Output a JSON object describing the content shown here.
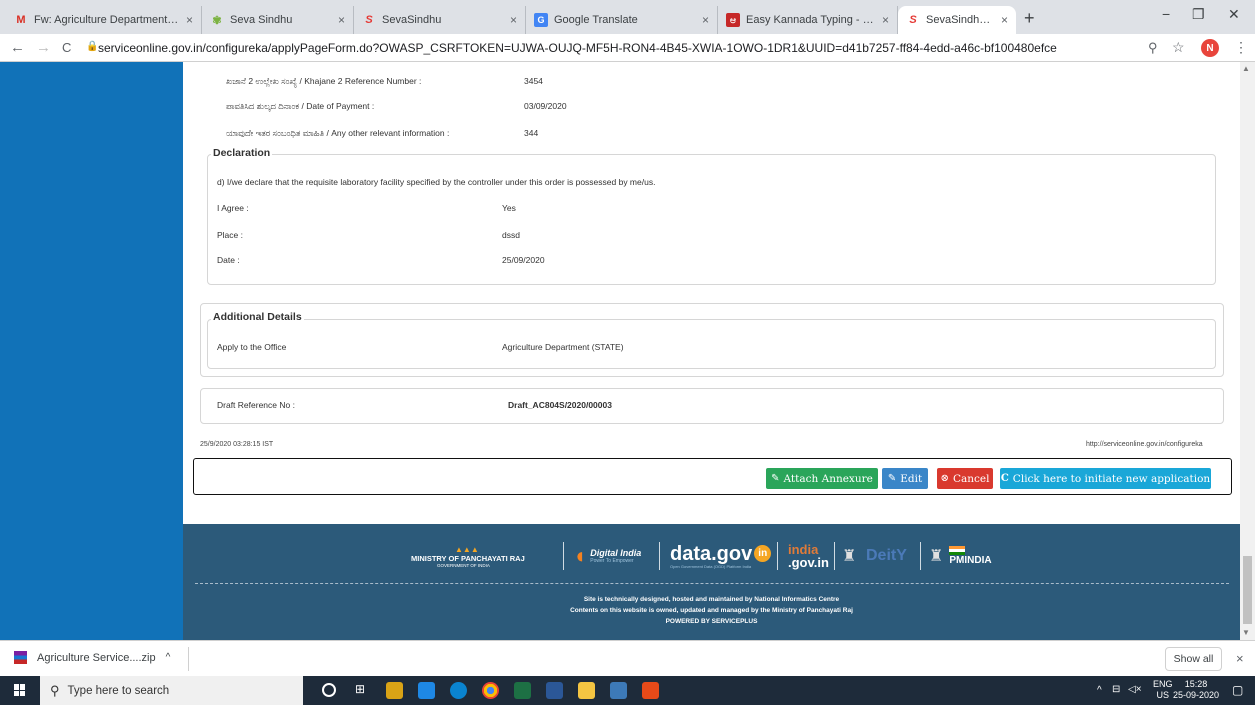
{
  "browser": {
    "tabs": [
      {
        "label": "Fw: Agriculture Department | R",
        "icon": "gmail-icon",
        "icon_char": "M",
        "icon_color": "#d93025"
      },
      {
        "label": "Seva Sindhu",
        "icon": "seva-sindhu-icon",
        "icon_char": "✾",
        "icon_color": "#7cb342"
      },
      {
        "label": "SevaSindhu",
        "icon": "sevasindhu-s-icon",
        "icon_char": "S",
        "icon_color": "#e53935"
      },
      {
        "label": "Google Translate",
        "icon": "translate-icon",
        "icon_char": "G",
        "icon_color": "#4285f4"
      },
      {
        "label": "Easy Kannada Typing - English",
        "icon": "kannada-typing-icon",
        "icon_char": "ಆ",
        "icon_color": "#c62828"
      },
      {
        "label": "SevaSindhu-PreProd",
        "icon": "sevasindhu-s-icon",
        "icon_char": "S",
        "icon_color": "#e53935"
      }
    ],
    "close_glyph": "×",
    "new_tab_glyph": "+",
    "window_controls": {
      "minimize": "−",
      "maximize": "❐",
      "close": "✕"
    },
    "url": "serviceonline.gov.in/configureka/applyPageForm.do?OWASP_CSRFTOKEN=UJWA-OUJQ-MF5H-RON4-4B45-XWIA-1OWO-1DR1&UUID=d41b7257-ff84-4edd-a46c-bf100480efce",
    "profile_initial": "N",
    "nav": {
      "back": "←",
      "forward": "→",
      "reload": "C",
      "lock": "🔒",
      "zoom": "⚲",
      "star": "☆",
      "menu": "⋮"
    }
  },
  "payment": {
    "fields": [
      {
        "label": "ಖಜಾನೆ 2 ಉಲ್ಲೇಖ ಸಂಖ್ಯೆ / Khajane 2 Reference Number :",
        "value": "3454"
      },
      {
        "label": "ಪಾವತಿಸಿದ ಶುಲ್ಕದ ದಿನಾಂಕ / Date of Payment :",
        "value": "03/09/2020"
      },
      {
        "label": "ಯಾವುದೇ ಇತರ ಸಂಬಂಧಿತ ಮಾಹಿತಿ / Any other relevant information :",
        "value": "344"
      }
    ]
  },
  "declaration": {
    "title": "Declaration",
    "statement": "d)  I/we declare that the requisite laboratory facility specified by the controller under this order is possessed by me/us.",
    "fields": [
      {
        "label": "I Agree :",
        "value": "Yes"
      },
      {
        "label": "Place :",
        "value": "dssd"
      },
      {
        "label": "Date :",
        "value": "25/09/2020"
      }
    ]
  },
  "additional": {
    "title": "Additional Details",
    "label": "Apply to the Office",
    "value": "Agriculture Department (STATE)"
  },
  "draft": {
    "label": "Draft Reference No :",
    "value": "Draft_AC804S/2020/00003"
  },
  "stamp": {
    "timestamp": "25/9/2020 03:28:15 IST",
    "url": "http://serviceonline.gov.in/configureka"
  },
  "actions": {
    "attach": {
      "label": "Attach Annexure",
      "icon": "✎",
      "color": "#2aa55a"
    },
    "edit": {
      "label": "Edit",
      "icon": "✎",
      "color": "#3a86c8"
    },
    "cancel": {
      "label": "Cancel",
      "icon": "⊗",
      "color": "#d9392e"
    },
    "new_app": {
      "label": "Click here to initiate new application",
      "icon": "C",
      "color": "#1aa7d8"
    }
  },
  "footer": {
    "logos": {
      "mopr": "MINISTRY OF PANCHAYATI RAJ",
      "mopr_sub": "GOVERNMENT OF INDIA",
      "digital_india": "Digital India",
      "digital_india_sub": "Power To Empower",
      "datagov": "data.gov",
      "datagov_badge": "in",
      "datagov_sub": "Open Government Data (OGD) Platform India",
      "indiagov_top": "india",
      "indiagov_bottom": ".gov.in",
      "dbt": "DeitY",
      "pmindia": "PMINDIA"
    },
    "line1": "Site is technically designed, hosted and maintained by National Informatics Centre",
    "line2": "Contents on this website is owned, updated and managed by the Ministry of Panchayati Raj",
    "line3": "POWERED BY SERVICEPLUS"
  },
  "download": {
    "file": "Agriculture Service....zip",
    "caret": "^",
    "show_all": "Show all",
    "close": "×"
  },
  "taskbar": {
    "search_placeholder": "Type here to search",
    "search_glyph": "⚲",
    "lang_top": "ENG",
    "lang_bottom": "US",
    "time": "15:28",
    "date": "25-09-2020",
    "tray_caret": "^",
    "volume": "◁×",
    "network": "⊟",
    "notify": "▢"
  }
}
